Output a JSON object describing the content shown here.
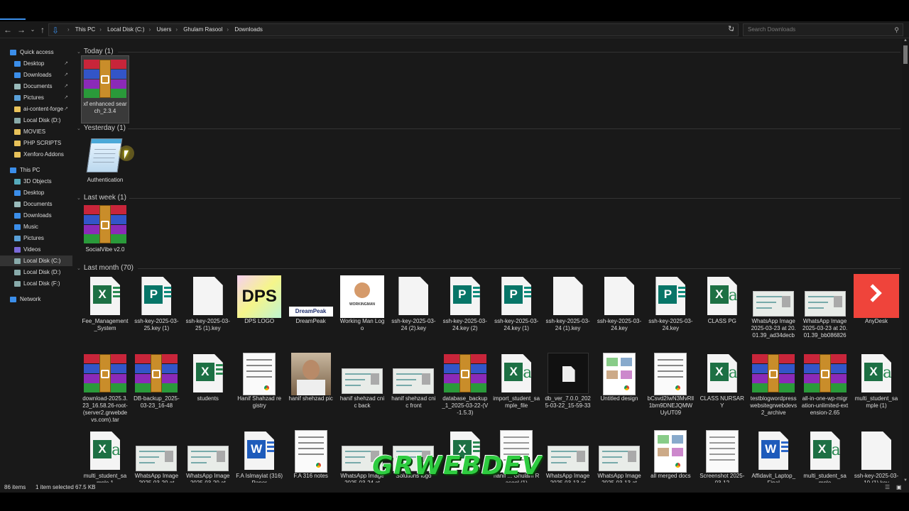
{
  "colors": {
    "accent": "#3b8eea",
    "excel": "#1d7044",
    "publisher": "#077568",
    "word": "#1e5bbb",
    "anydesk": "#ef443b",
    "watermark": "#2ecc40"
  },
  "address": {
    "parts": [
      "This PC",
      "Local Disk (C:)",
      "Users",
      "Ghulam Rasool",
      "Downloads"
    ],
    "search_placeholder": "Search Downloads"
  },
  "sidebar": {
    "items": [
      {
        "label": "Quick access",
        "icon": "star-icon",
        "pinned": false
      },
      {
        "label": "Desktop",
        "icon": "desktop-icon",
        "pinned": true
      },
      {
        "label": "Downloads",
        "icon": "download-icon",
        "pinned": true
      },
      {
        "label": "Documents",
        "icon": "documents-icon",
        "pinned": true
      },
      {
        "label": "Pictures",
        "icon": "pictures-icon",
        "pinned": true
      },
      {
        "label": "ai-content-forge",
        "icon": "folder-icon",
        "pinned": true
      },
      {
        "label": "Local Disk (D:)",
        "icon": "drive-icon",
        "pinned": false
      },
      {
        "label": "MOVIES",
        "icon": "folder-icon",
        "pinned": false
      },
      {
        "label": "PHP SCRIPTS",
        "icon": "folder-icon",
        "pinned": false
      },
      {
        "label": "Xenforo Addons",
        "icon": "folder-icon",
        "pinned": false
      },
      {
        "label": "This PC",
        "icon": "computer-icon",
        "pinned": false
      },
      {
        "label": "3D Objects",
        "icon": "cube-icon",
        "pinned": false
      },
      {
        "label": "Desktop",
        "icon": "desktop-icon",
        "pinned": false
      },
      {
        "label": "Documents",
        "icon": "documents-icon",
        "pinned": false
      },
      {
        "label": "Downloads",
        "icon": "download-icon",
        "pinned": false
      },
      {
        "label": "Music",
        "icon": "music-icon",
        "pinned": false
      },
      {
        "label": "Pictures",
        "icon": "pictures-icon",
        "pinned": false
      },
      {
        "label": "Videos",
        "icon": "video-icon",
        "pinned": false
      },
      {
        "label": "Local Disk (C:)",
        "icon": "drive-icon",
        "pinned": false
      },
      {
        "label": "Local Disk (D:)",
        "icon": "drive-icon",
        "pinned": false
      },
      {
        "label": "Local Disk (F:)",
        "icon": "drive-icon",
        "pinned": false
      },
      {
        "label": "Network",
        "icon": "network-icon",
        "pinned": false
      }
    ]
  },
  "groups": [
    {
      "label": "Today (1)",
      "items": [
        {
          "name": "xf enhanced search_2.3.4",
          "type": "rar",
          "selected": true
        }
      ]
    },
    {
      "label": "Yesterday (1)",
      "items": [
        {
          "name": "Authentication",
          "type": "notepad"
        }
      ]
    },
    {
      "label": "Last week (1)",
      "items": [
        {
          "name": "SocialVibe v2.0",
          "type": "rar"
        }
      ]
    },
    {
      "label": "Last month (70)",
      "items": [
        {
          "name": "Fee_Management_System",
          "type": "excel"
        },
        {
          "name": "ssh-key-2025-03-25.key (1)",
          "type": "publisher"
        },
        {
          "name": "ssh-key-2025-03-25 (1).key",
          "type": "blank"
        },
        {
          "name": "DPS LOGO",
          "type": "dps",
          "logo": "DPS"
        },
        {
          "name": "DreamPeak",
          "type": "dreampeak",
          "logo": "DreamPeak"
        },
        {
          "name": "Working Man Logo",
          "type": "workingman",
          "logo": "WORKINGMAN"
        },
        {
          "name": "ssh-key-2025-03-24 (2).key",
          "type": "blank"
        },
        {
          "name": "ssh-key-2025-03-24.key (2)",
          "type": "publisher"
        },
        {
          "name": "ssh-key-2025-03-24.key (1)",
          "type": "publisher"
        },
        {
          "name": "ssh-key-2025-03-24 (1).key",
          "type": "blank"
        },
        {
          "name": "ssh-key-2025-03-24.key",
          "type": "blank"
        },
        {
          "name": "ssh-key-2025-03-24.key",
          "type": "publisher"
        },
        {
          "name": "CLASS PG",
          "type": "excelcsv"
        },
        {
          "name": "WhatsApp Image 2025-03-23 at 20.01.39_ad34decb",
          "type": "card"
        },
        {
          "name": "WhatsApp Image 2025-03-23 at 20.01.39_bb086826",
          "type": "card"
        },
        {
          "name": "AnyDesk",
          "type": "anydesk"
        },
        {
          "name": "download-2025.3.23_16.58.26-root-(server2.grwebdevs.com).tar",
          "type": "rar"
        },
        {
          "name": "DB-backup_2025-03-23_16-48",
          "type": "rar"
        },
        {
          "name": "students",
          "type": "excel"
        },
        {
          "name": "Hanif Shahzad registry",
          "type": "paperchrome"
        },
        {
          "name": "hanif shehzad pic",
          "type": "photo"
        },
        {
          "name": "hanif shehzad cnic back",
          "type": "card"
        },
        {
          "name": "hanif shehzad cnic front",
          "type": "card"
        },
        {
          "name": "database_backup_1_2025-03-22-(V-1.5.3)",
          "type": "rar"
        },
        {
          "name": "import_student_sample_file",
          "type": "excelcsv"
        },
        {
          "name": "db_ver_7.0.0_2025-03-22_15-59-33",
          "type": "darkfile"
        },
        {
          "name": "Untitled design",
          "type": "collagechrome"
        },
        {
          "name": "bCsvd2IwN3MvRll1bm9DNEJQMWUyUT09",
          "type": "paperchrome"
        },
        {
          "name": "CLASS NURSARY",
          "type": "excelcsv"
        },
        {
          "name": "testblogwordpresswebsitegrwebdevs2_archive",
          "type": "rar"
        },
        {
          "name": "all-in-one-wp-migration-unlimited-extension-2.65",
          "type": "rar"
        },
        {
          "name": "multi_student_sample (1)",
          "type": "excelcsv"
        },
        {
          "name": "multi_student_sample 1",
          "type": "excelcsv"
        },
        {
          "name": "WhatsApp Image 2025-03-20 at",
          "type": "card"
        },
        {
          "name": "WhatsApp Image 2025-03-20 at",
          "type": "card"
        },
        {
          "name": "F.A Islmayiat (316) Paper",
          "type": "word"
        },
        {
          "name": "F.A 316 notes",
          "type": "paperchrome"
        },
        {
          "name": "WhatsApp Image 2025-03-24 at",
          "type": "card"
        },
        {
          "name": "Solutions logo",
          "type": "card"
        },
        {
          "name": "",
          "type": "excel"
        },
        {
          "name": "hanif ... Ghulam Rasool (1)",
          "type": "paper"
        },
        {
          "name": "WhatsApp Image 2025-03-13 at",
          "type": "card"
        },
        {
          "name": "WhatsApp Image 2025-03-13 at",
          "type": "card"
        },
        {
          "name": "all merged docs",
          "type": "collagechrome"
        },
        {
          "name": "Screenshot 2025-03-12",
          "type": "paper"
        },
        {
          "name": "Affidavit_Laptop_Final",
          "type": "word"
        },
        {
          "name": "multi_student_sample",
          "type": "excelcsv"
        },
        {
          "name": "ssh-key-2025-03-10 (1).key",
          "type": "blank"
        }
      ]
    }
  ],
  "status": {
    "count": "86 items",
    "selection": "1 item selected  67.5 KB"
  },
  "watermark": "GRWEBDEV"
}
